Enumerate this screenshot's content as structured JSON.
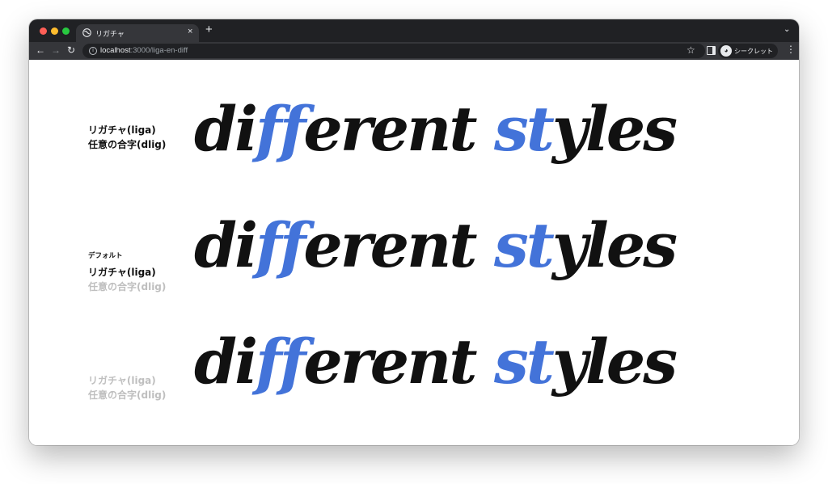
{
  "browser": {
    "tab_title": "リガチャ",
    "tab_close": "×",
    "new_tab": "+",
    "tab_menu": "⌄",
    "url_host": "localhost",
    "url_path": ":3000/liga-en-diff",
    "profile_label": "シークレット",
    "icons": {
      "back": "←",
      "forward": "→",
      "reload": "↻",
      "bookmark": "☆",
      "menu": "⋮",
      "info": "i"
    }
  },
  "rows": [
    {
      "heading": "",
      "liga_label": "リガチャ(liga)",
      "dlig_label": "任意の合字(dlig)",
      "liga_on": true,
      "dlig_on": true,
      "sample": {
        "p1": "di",
        "p2": "ff",
        "p3": "erent ",
        "p4": "st",
        "p5": "yles"
      }
    },
    {
      "heading": "デフォルト",
      "liga_label": "リガチャ(liga)",
      "dlig_label": "任意の合字(dlig)",
      "liga_on": true,
      "dlig_on": false,
      "sample": {
        "p1": "di",
        "p2": "ff",
        "p3": "erent ",
        "p4": "st",
        "p5": "yles"
      }
    },
    {
      "heading": "",
      "liga_label": "リガチャ(liga)",
      "dlig_label": "任意の合字(dlig)",
      "liga_on": false,
      "dlig_on": false,
      "sample": {
        "p1": "di",
        "p2": "ff",
        "p3": "erent ",
        "p4": "st",
        "p5": "yles"
      }
    }
  ],
  "colors": {
    "highlight": "#4373d9",
    "text": "#111111",
    "disabled": "#bfbfbf",
    "chrome_dark": "#202124",
    "chrome_tab": "#35363a"
  }
}
